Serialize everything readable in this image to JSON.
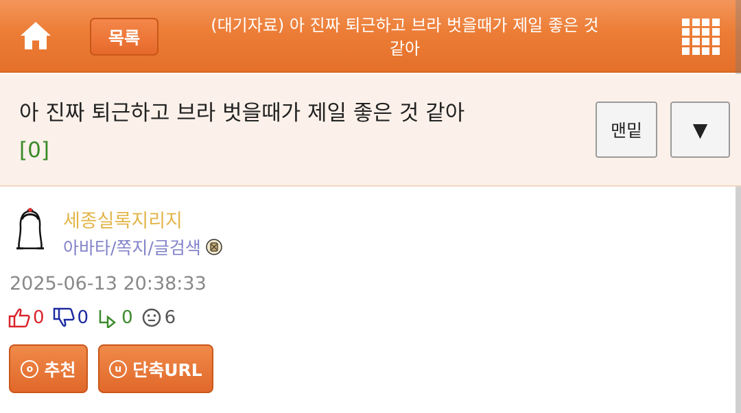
{
  "header": {
    "list_label": "목록",
    "title": "(대기자료) 아 진짜 퇴근하고 브라 벗을때가 제일 좋은 것 같아"
  },
  "post": {
    "title": "아 진짜 퇴근하고 브라 벗을때가 제일 좋은 것 같아",
    "comment_count": "[0]",
    "bottom_label": "맨밑",
    "down_label": "▼"
  },
  "author": {
    "name": "세종실록지리지",
    "links": "아바타/쪽지/글검색"
  },
  "meta": {
    "date": "2025-06-13 20:38:33",
    "upvotes": "0",
    "downvotes": "0",
    "replies": "0",
    "views": "6"
  },
  "actions": {
    "recommend_icon": "o",
    "recommend_label": "추천",
    "shorturl_icon": "u",
    "shorturl_label": "단축URL"
  },
  "colors": {
    "header_orange": "#ec7d36",
    "author_name": "#e3b54a",
    "author_links": "#8282c9",
    "upvote": "#d9242b",
    "downvote": "#1c2aa0",
    "reply": "#3a8a2a"
  }
}
